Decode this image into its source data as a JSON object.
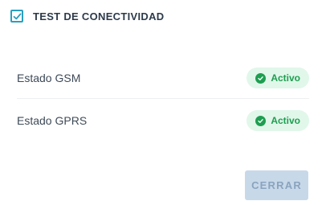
{
  "header": {
    "title": "TEST DE CONECTIVIDAD",
    "checkbox_checked": true,
    "checkbox_icon": "check-icon"
  },
  "status_rows": [
    {
      "label": "Estado GSM",
      "status": "Activo",
      "status_icon": "check-circle-icon"
    },
    {
      "label": "Estado GPRS",
      "status": "Activo",
      "status_icon": "check-circle-icon"
    }
  ],
  "footer": {
    "close_label": "CERRAR"
  },
  "colors": {
    "accent": "#2a9fbf",
    "success": "#1e9e50",
    "success_bg": "#e1f7ea",
    "button_bg": "#c7d8e9",
    "button_text": "#8aa4be"
  }
}
